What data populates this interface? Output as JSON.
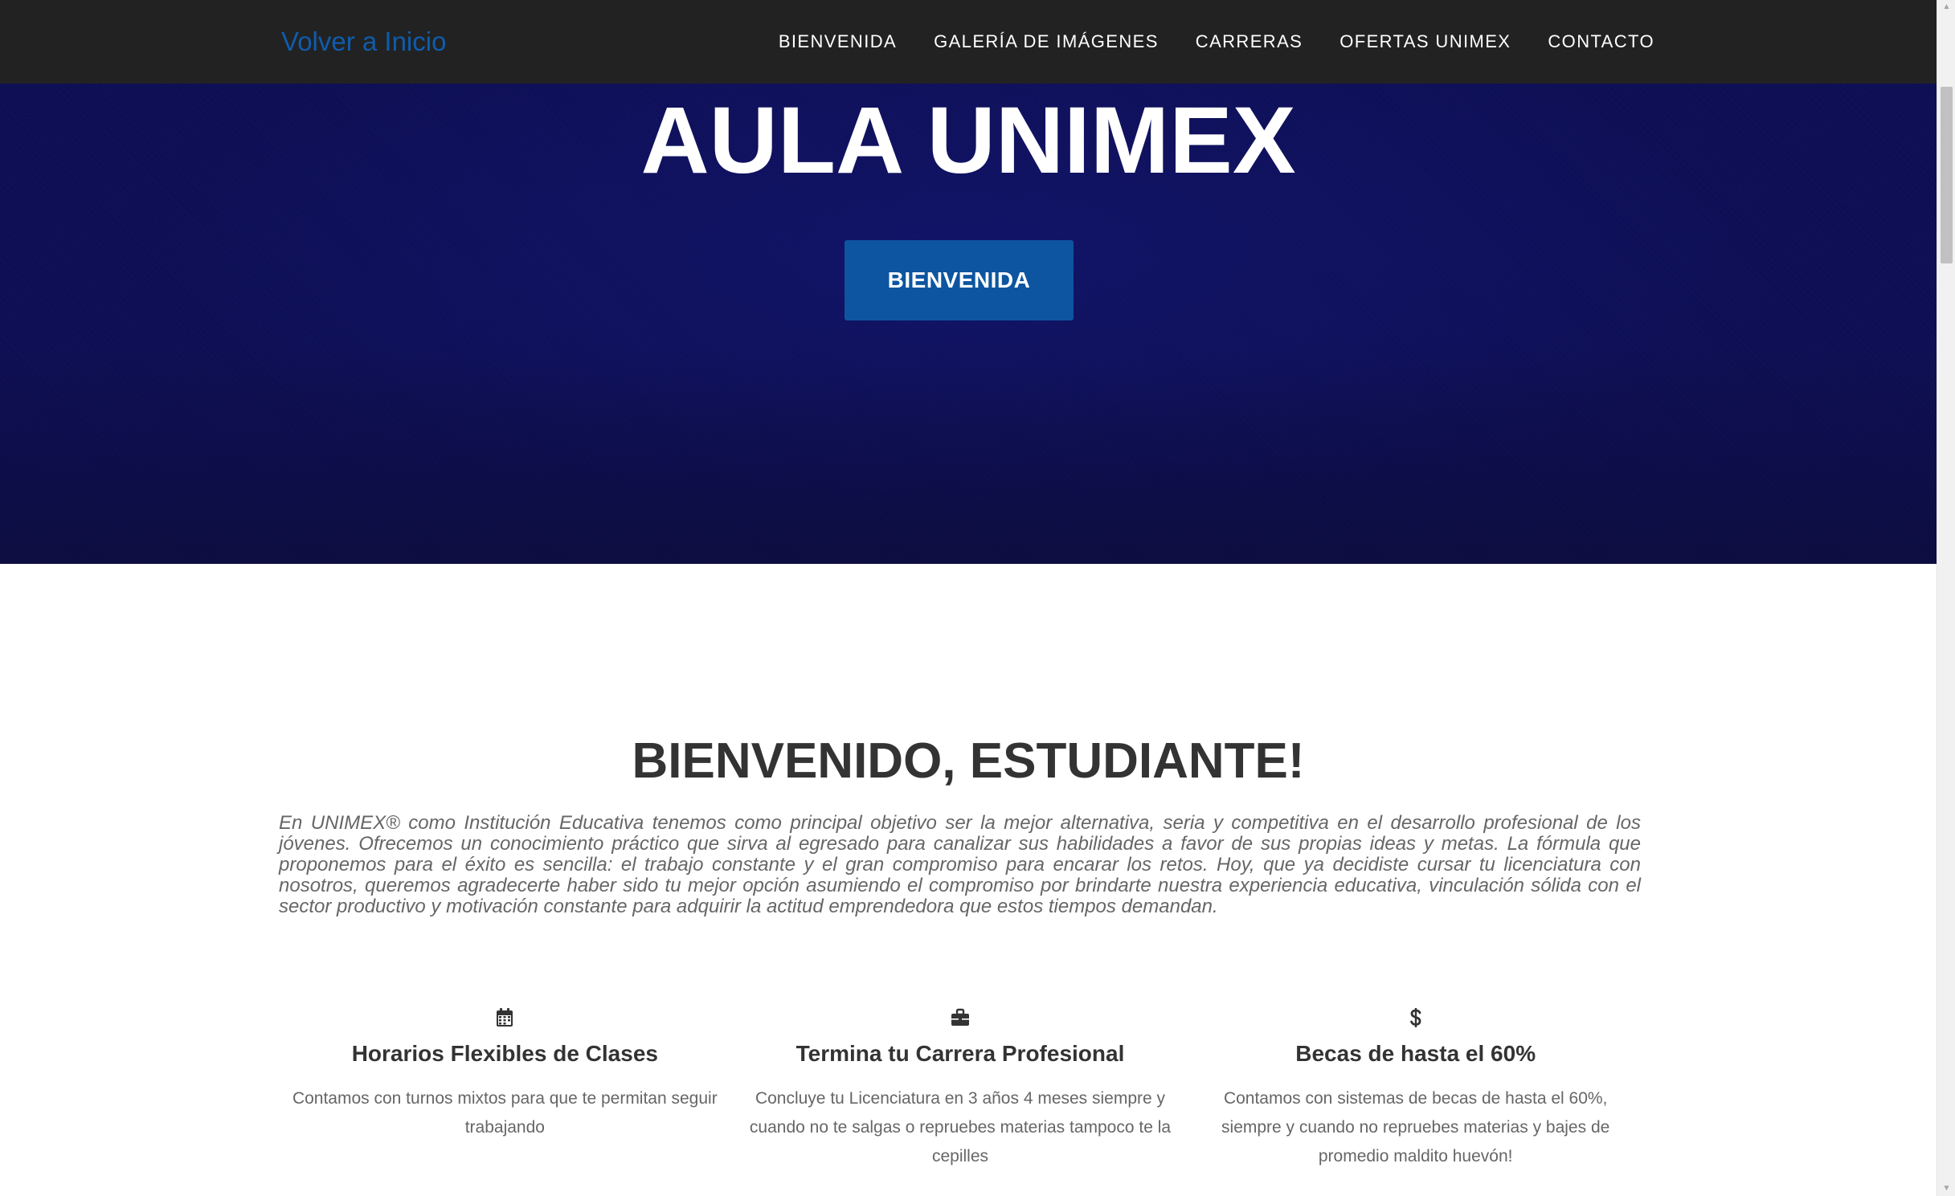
{
  "navbar": {
    "brand": "Volver a Inicio",
    "links": [
      "Bienvenida",
      "Galería de imágenes",
      "Carreras",
      "Ofertas UNIMEX",
      "Contacto"
    ]
  },
  "hero": {
    "title": "AULA UNIMEX",
    "button_label": "BIENVENIDA"
  },
  "welcome": {
    "heading": "BIENVENIDO, ESTUDIANTE!",
    "text": "En UNIMEX® como Institución Educativa tenemos como principal objetivo ser la mejor alternativa, seria y competitiva en el desarrollo profesional de los jóvenes. Ofrecemos un conocimiento práctico que sirva al egresado para canalizar sus habilidades a favor de sus propias ideas y metas. La fórmula que proponemos para el éxito es sencilla: el trabajo constante y el gran compromiso para encarar los retos. Hoy, que ya decidiste cursar tu licenciatura con nosotros, queremos agradecerte haber sido tu mejor opción asumiendo el compromiso por brindarte nuestra experiencia educativa, vinculación sólida con el sector productivo y motivación constante para adquirir la actitud emprendedora que estos tiempos demandan."
  },
  "features": [
    {
      "icon": "calendar-icon",
      "title": "Horarios Flexibles de Clases",
      "text": "Contamos con turnos mixtos para que te permitan seguir trabajando"
    },
    {
      "icon": "briefcase-icon",
      "title": "Termina tu Carrera Profesional",
      "text": "Concluye tu Licenciatura en 3 años 4 meses siempre y cuando no te salgas o repruebes materias tampoco te la cepilles"
    },
    {
      "icon": "dollar-icon",
      "title": "Becas de hasta el 60%",
      "text": "Contamos con sistemas de becas de hasta el 60%, siempre y cuando no repruebes materias y bajes de promedio maldito huevón!"
    }
  ],
  "colors": {
    "navbar_bg": "#222222",
    "brand_link": "#0f5cad",
    "hero_bg": "#0c0d55",
    "button_bg": "#0d55a0",
    "heading_text": "#333333",
    "body_text": "#666666"
  }
}
